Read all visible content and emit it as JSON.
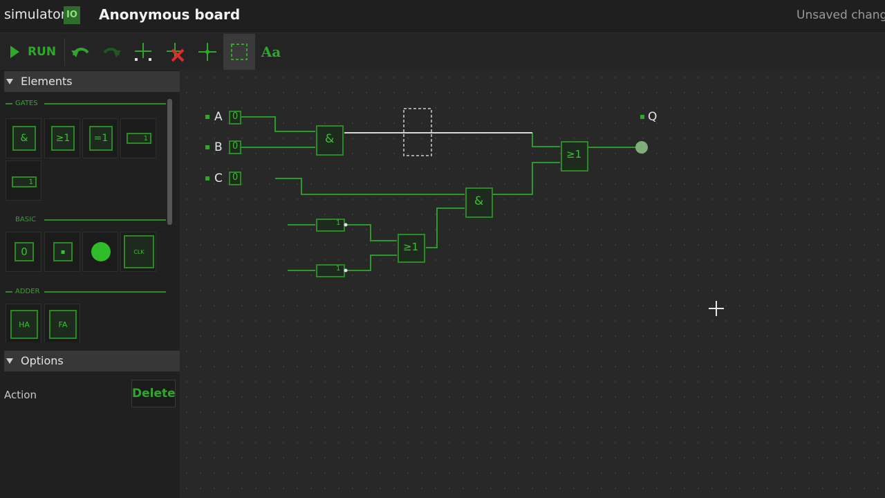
{
  "app": {
    "brand": "simulator",
    "brand_badge": "IO",
    "board_title": "Anonymous board",
    "save_status": "Unsaved changes"
  },
  "toolbar": {
    "run_label": "RUN",
    "text_tool_label": "Aa",
    "icons": [
      "undo-icon",
      "redo-icon",
      "add-wire-icon",
      "delete-wire-icon",
      "add-junction-icon",
      "select-icon",
      "text-icon"
    ]
  },
  "sidebar": {
    "elements_header": "Elements",
    "categories": {
      "gates": "GATES",
      "basic": "BASIC",
      "adder": "ADDER"
    },
    "gates": [
      "&",
      "≥1",
      "=1",
      "1",
      "1"
    ],
    "basic": [
      "0",
      "▪",
      "",
      "CLK"
    ],
    "adder": [
      "HA",
      "FA"
    ],
    "options_header": "Options",
    "action_label": "Action",
    "delete_label": "Delete"
  },
  "circuit": {
    "inputs": [
      {
        "name": "A",
        "value": "0"
      },
      {
        "name": "B",
        "value": "0"
      },
      {
        "name": "C",
        "value": "0"
      }
    ],
    "output": {
      "name": "Q"
    },
    "gates": {
      "and_top": "&",
      "or_out": "≥1",
      "and_mid": "&",
      "or_low": "≥1",
      "not_1": "1",
      "not_2": "1"
    }
  },
  "colors": {
    "accent": "#2ea82a",
    "wire": "#2c9a28",
    "selected_wire": "#d8d8d8",
    "output_led": "#7fae7a"
  }
}
